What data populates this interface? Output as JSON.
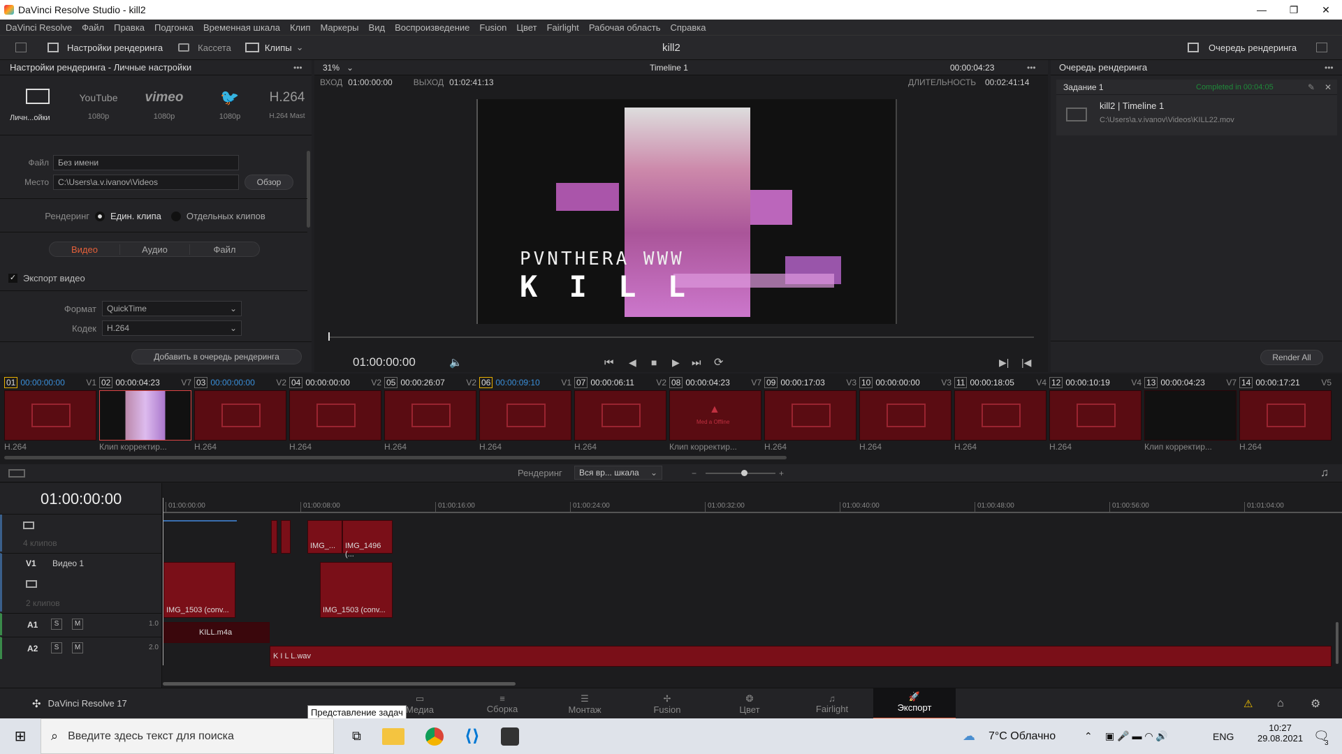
{
  "window": {
    "title": "DaVinci Resolve Studio - kill2",
    "minimize": "—",
    "maximize": "❐",
    "close": "✕"
  },
  "menu": [
    "DaVinci Resolve",
    "Файл",
    "Правка",
    "Подгонка",
    "Временная шкала",
    "Клип",
    "Маркеры",
    "Вид",
    "Воспроизведение",
    "Fusion",
    "Цвет",
    "Fairlight",
    "Рабочая область",
    "Справка"
  ],
  "toolbar": {
    "render_settings": "Настройки рендеринга",
    "tape": "Кассета",
    "clips": "Клипы",
    "project": "kill2",
    "render_queue": "Очередь рендеринга"
  },
  "left": {
    "header": "Настройки рендеринга - Личные настройки",
    "presets": [
      {
        "name": "Личн...ойки",
        "sub": ""
      },
      {
        "name": "YouTube",
        "sub": "1080p"
      },
      {
        "name": "vimeo",
        "sub": "1080p"
      },
      {
        "name": "Twitter",
        "sub": "1080p"
      },
      {
        "name": "H.264",
        "sub": "H.264 Mast"
      }
    ],
    "file_label": "Файл",
    "file_value": "Без имени",
    "place_label": "Место",
    "place_value": "C:\\Users\\a.v.ivanov\\Videos",
    "browse": "Обзор",
    "render_label": "Рендеринг",
    "single_clip": "Един. клипа",
    "separate_clips": "Отдельных клипов",
    "tabs": [
      "Видео",
      "Аудио",
      "Файл"
    ],
    "export_video": "Экспорт видео",
    "format_label": "Формат",
    "format_value": "QuickTime",
    "codec_label": "Кодек",
    "codec_value": "H.264",
    "add_queue": "Добавить в очередь рендеринга"
  },
  "viewer": {
    "zoom": "31%",
    "timeline": "Timeline 1",
    "timecode_top": "00:00:04:23",
    "in_label": "ВХОД",
    "in_value": "01:00:00:00",
    "out_label": "ВЫХОД",
    "out_value": "01:02:41:13",
    "dur_label": "ДЛИТЕЛЬНОСТЬ",
    "dur_value": "00:02:41:14",
    "overlay_line1": "PVNTHERA WWW",
    "overlay_line2": "K I L L",
    "timecode": "01:00:00:00"
  },
  "queue": {
    "header": "Очередь рендеринга",
    "job": "Задание 1",
    "status": "Completed in 00:04:05",
    "item_title": "kill2 | Timeline 1",
    "item_path": "C:\\Users\\a.v.ivanov\\Videos\\KILL22.mov",
    "render_all": "Render All"
  },
  "strip": [
    {
      "n": "01",
      "tc": "00:00:00:00",
      "tr": "V1",
      "codec": "H.264",
      "blue": true
    },
    {
      "n": "02",
      "tc": "00:00:04:23",
      "tr": "V7",
      "codec": "Клип корректир...",
      "blue": false
    },
    {
      "n": "03",
      "tc": "00:00:00:00",
      "tr": "V2",
      "codec": "H.264",
      "blue": true
    },
    {
      "n": "04",
      "tc": "00:00:00:00",
      "tr": "V2",
      "codec": "H.264",
      "blue": false
    },
    {
      "n": "05",
      "tc": "00:00:26:07",
      "tr": "V2",
      "codec": "H.264",
      "blue": false
    },
    {
      "n": "06",
      "tc": "00:00:09:10",
      "tr": "V1",
      "codec": "H.264",
      "blue": true
    },
    {
      "n": "07",
      "tc": "00:00:06:11",
      "tr": "V2",
      "codec": "H.264",
      "blue": false
    },
    {
      "n": "08",
      "tc": "00:00:04:23",
      "tr": "V7",
      "codec": "Клип корректир...",
      "blue": false
    },
    {
      "n": "09",
      "tc": "00:00:17:03",
      "tr": "V3",
      "codec": "H.264",
      "blue": false
    },
    {
      "n": "10",
      "tc": "00:00:00:00",
      "tr": "V3",
      "codec": "H.264",
      "blue": false
    },
    {
      "n": "11",
      "tc": "00:00:18:05",
      "tr": "V4",
      "codec": "H.264",
      "blue": false
    },
    {
      "n": "12",
      "tc": "00:00:10:19",
      "tr": "V4",
      "codec": "H.264",
      "blue": false
    },
    {
      "n": "13",
      "tc": "00:00:04:23",
      "tr": "V7",
      "codec": "Клип корректир...",
      "blue": false
    },
    {
      "n": "14",
      "tc": "00:00:17:21",
      "tr": "V5",
      "codec": "H.264",
      "blue": false
    }
  ],
  "strip_media_offline": "Med a Offline",
  "timeline": {
    "render_label": "Рендеринг",
    "render_value": "Вся вр... шкала",
    "playhead_tc": "01:00:00:00",
    "ruler": [
      "01:00:00:00",
      "01:00:08:00",
      "01:00:16:00",
      "01:00:24:00",
      "01:00:32:00",
      "01:00:40:00",
      "01:00:48:00",
      "01:00:56:00",
      "01:01:04:00"
    ],
    "track_top_count": "4 клипов",
    "v1": "V1",
    "v1_name": "Видео 1",
    "v1_count": "2 клипов",
    "a1": "A1",
    "a1_level": "1.0",
    "a2": "A2",
    "a2_level": "2.0",
    "solo": "S",
    "mute": "M",
    "clips": {
      "img1": "IMG_...",
      "img2": "IMG_1496 (...",
      "img3": "IMG_1503 (conv...",
      "img4": "IMG_1503 (conv...",
      "kill": "KILL.m4a",
      "killwav": "K I L L.wav"
    }
  },
  "pages": {
    "app": "DaVinci Resolve 17",
    "tooltip": "Представление задач",
    "items": [
      "Медиа",
      "Сборка",
      "Монтаж",
      "Fusion",
      "Цвет",
      "Fairlight",
      "Экспорт"
    ]
  },
  "taskbar": {
    "search": "Введите здесь текст для поиска",
    "weather": "7°C Облачно",
    "lang": "ENG",
    "time": "10:27",
    "date": "29.08.2021",
    "notif": "3"
  }
}
